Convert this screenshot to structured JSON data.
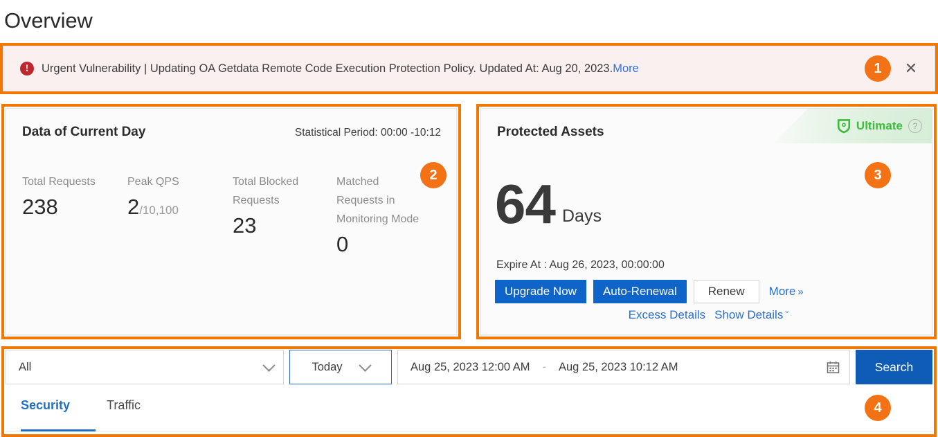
{
  "page": {
    "title": "Overview"
  },
  "alert": {
    "icon": "exclamation-circle-icon",
    "text": "Urgent Vulnerability | Updating OA Getdata Remote Code Execution Protection Policy. Updated At: Aug 20, 2023.",
    "more_label": "More",
    "close_label": "✕",
    "accent_color": "#c0272d",
    "background_color": "#f9f0ef"
  },
  "annotations": {
    "badge_color": "#f47216",
    "markers": [
      {
        "number": "1",
        "target": "alert-banner"
      },
      {
        "number": "2",
        "target": "data-of-current-day-card"
      },
      {
        "number": "3",
        "target": "protected-assets-card"
      },
      {
        "number": "4",
        "target": "filter-and-tabs"
      }
    ]
  },
  "current_day_card": {
    "title": "Data of Current Day",
    "statistical_period": "Statistical Period: 00:00 -10:12",
    "stats": [
      {
        "label": "Total Requests",
        "value": "238",
        "suffix": ""
      },
      {
        "label": "Peak QPS",
        "value": "2",
        "suffix": "/10,100"
      },
      {
        "label": "Total Blocked Requests",
        "value": "23",
        "suffix": ""
      },
      {
        "label": "Matched Requests in Monitoring Mode",
        "value": "0",
        "suffix": ""
      }
    ]
  },
  "protected_assets_card": {
    "title": "Protected Assets",
    "edition_badge": {
      "icon": "shield-icon",
      "label": "Ultimate",
      "help_icon": "question-mark-icon",
      "color": "#3dbb3d"
    },
    "days_number": "64",
    "days_unit": "Days",
    "expire_at": "Expire At : Aug 26, 2023, 00:00:00",
    "buttons": [
      {
        "label": "Upgrade Now",
        "style": "primary"
      },
      {
        "label": "Auto-Renewal",
        "style": "primary"
      },
      {
        "label": "Renew",
        "style": "outline"
      }
    ],
    "more_link": "More",
    "more_chevron": "»",
    "sub_links": [
      {
        "label": "Excess Details",
        "chevron": ""
      },
      {
        "label": "Show Details",
        "chevron": "ˇ"
      }
    ]
  },
  "filter_bar": {
    "scope_select": {
      "value": "All",
      "icon": "chevron-down-icon"
    },
    "period_select": {
      "value": "Today",
      "icon": "chevron-down-icon"
    },
    "date_range": {
      "start": "Aug 25, 2023 12:00 AM",
      "separator": "-",
      "end": "Aug 25, 2023 10:12 AM",
      "icon": "calendar-icon"
    },
    "search_button": "Search"
  },
  "tabs": [
    {
      "label": "Security",
      "active": true
    },
    {
      "label": "Traffic",
      "active": false
    }
  ]
}
